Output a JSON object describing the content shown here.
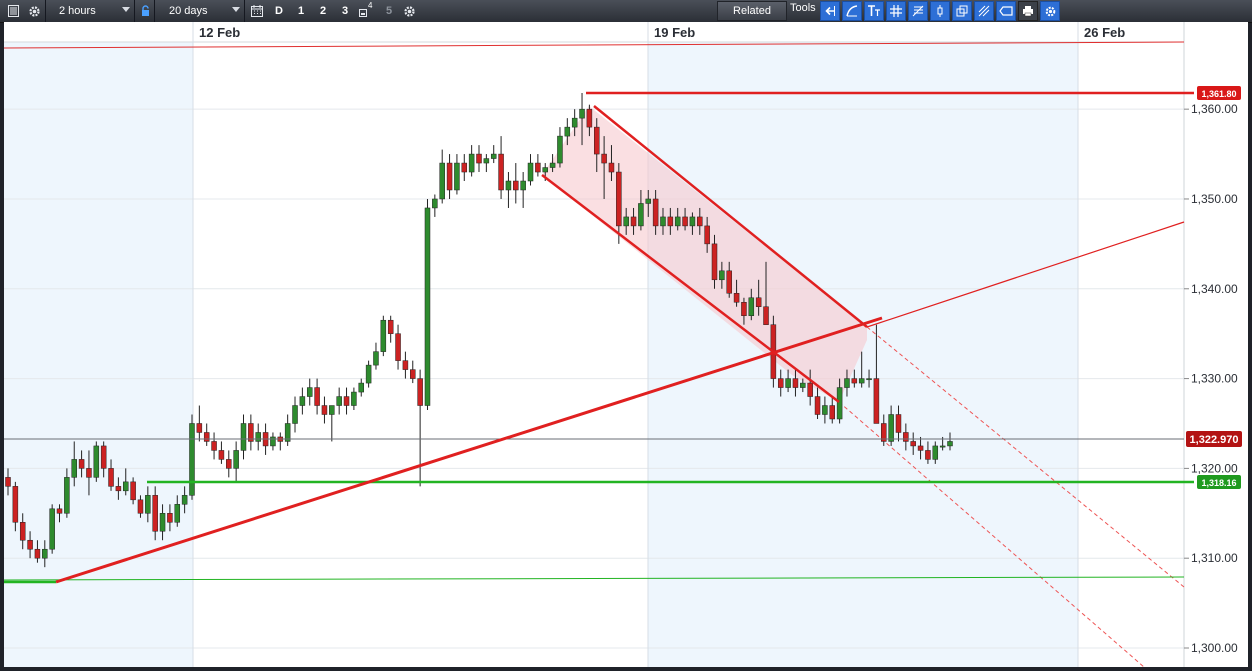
{
  "toolbar": {
    "interval": "2 hours",
    "range": "20 days",
    "period_d": "D",
    "period_1": "1",
    "period_2": "2",
    "period_3": "3",
    "period_4_sup": "4",
    "period_5": "5",
    "related": "Related",
    "tools": "Tools",
    "tool_icons": [
      "arrow-back-icon",
      "curve-icon",
      "text-tool-icon",
      "grid-icon",
      "fib-icon",
      "candle-icon",
      "layers-icon",
      "pitchfork-icon",
      "tag-icon",
      "print-icon",
      "settings-blue-icon"
    ]
  },
  "chart_data": {
    "type": "candlestick",
    "x_dates": [
      "12 Feb",
      "19 Feb",
      "26 Feb"
    ],
    "yticks": [
      "1,360.00",
      "1,350.00",
      "1,340.00",
      "1,330.00",
      "1,320.00",
      "1,310.00",
      "1,300.00"
    ],
    "ylim": [
      1297,
      1367
    ],
    "last_price": "1,322.970",
    "resistance_label": "1,361.80",
    "support_label": "1,318.16",
    "colors": {
      "up": "#2e8b2e",
      "down": "#cc2222",
      "resistance": "#e02020",
      "support": "#22b422"
    },
    "candles": [
      [
        1319,
        1320,
        1317,
        1318
      ],
      [
        1318,
        1318.5,
        1313,
        1314
      ],
      [
        1314,
        1315,
        1311,
        1312
      ],
      [
        1312,
        1313,
        1310,
        1311
      ],
      [
        1311,
        1312,
        1309.5,
        1310
      ],
      [
        1310,
        1312,
        1309,
        1311
      ],
      [
        1311,
        1316,
        1310.5,
        1315.5
      ],
      [
        1315.5,
        1316,
        1314,
        1315
      ],
      [
        1315,
        1320,
        1314.5,
        1319
      ],
      [
        1319,
        1323,
        1318,
        1321
      ],
      [
        1321,
        1322,
        1319,
        1320
      ],
      [
        1320,
        1322,
        1317,
        1319
      ],
      [
        1319,
        1323,
        1318.5,
        1322.5
      ],
      [
        1322.5,
        1323,
        1319,
        1320
      ],
      [
        1320,
        1321,
        1317.5,
        1318
      ],
      [
        1318,
        1319,
        1316.5,
        1317.5
      ],
      [
        1317.5,
        1320,
        1317,
        1318.5
      ],
      [
        1318.5,
        1319,
        1316,
        1316.5
      ],
      [
        1316.5,
        1317,
        1314.5,
        1315
      ],
      [
        1315,
        1318,
        1314,
        1317
      ],
      [
        1317,
        1318,
        1312,
        1313
      ],
      [
        1313,
        1316,
        1312,
        1315
      ],
      [
        1315,
        1316,
        1313,
        1314
      ],
      [
        1314,
        1317,
        1313.5,
        1316
      ],
      [
        1316,
        1318,
        1315,
        1317
      ],
      [
        1317,
        1326,
        1316.5,
        1325
      ],
      [
        1325,
        1327,
        1323,
        1324
      ],
      [
        1324,
        1325,
        1322.5,
        1323
      ],
      [
        1323,
        1324,
        1321,
        1322
      ],
      [
        1322,
        1323,
        1320.5,
        1321
      ],
      [
        1321,
        1322,
        1319,
        1320
      ],
      [
        1320,
        1323,
        1318.5,
        1322
      ],
      [
        1322,
        1326,
        1321,
        1325
      ],
      [
        1325,
        1326,
        1322,
        1323
      ],
      [
        1323,
        1325,
        1322,
        1324
      ],
      [
        1324,
        1325,
        1321.5,
        1322.5
      ],
      [
        1322.5,
        1324,
        1322,
        1323.5
      ],
      [
        1323.5,
        1324,
        1322,
        1323
      ],
      [
        1323,
        1326,
        1322.5,
        1325
      ],
      [
        1325,
        1328,
        1324,
        1327
      ],
      [
        1327,
        1329,
        1326,
        1328
      ],
      [
        1328,
        1330,
        1327,
        1329
      ],
      [
        1329,
        1330,
        1326,
        1327
      ],
      [
        1327,
        1328,
        1325,
        1326
      ],
      [
        1326,
        1327,
        1323,
        1327
      ],
      [
        1327,
        1329,
        1326,
        1328
      ],
      [
        1328,
        1329,
        1326,
        1327
      ],
      [
        1327,
        1329,
        1326.5,
        1328.5
      ],
      [
        1328.5,
        1330,
        1328,
        1329.5
      ],
      [
        1329.5,
        1332,
        1329,
        1331.5
      ],
      [
        1331.5,
        1334,
        1331,
        1333
      ],
      [
        1333,
        1337,
        1332.5,
        1336.5
      ],
      [
        1336.5,
        1337,
        1334,
        1335
      ],
      [
        1335,
        1336,
        1331,
        1332
      ],
      [
        1332,
        1333,
        1330,
        1331
      ],
      [
        1331,
        1332,
        1329.5,
        1330
      ],
      [
        1330,
        1331,
        1318,
        1327
      ],
      [
        1327,
        1350,
        1326.5,
        1349
      ],
      [
        1349,
        1350.5,
        1348,
        1350
      ],
      [
        1350,
        1355.5,
        1349.5,
        1354
      ],
      [
        1354,
        1355,
        1350,
        1351
      ],
      [
        1351,
        1355,
        1350.5,
        1354
      ],
      [
        1354,
        1355,
        1352,
        1353
      ],
      [
        1353,
        1356,
        1352.5,
        1355
      ],
      [
        1355,
        1356,
        1353,
        1354
      ],
      [
        1354,
        1355,
        1353,
        1354.5
      ],
      [
        1354.5,
        1356,
        1354,
        1355
      ],
      [
        1355,
        1357,
        1350,
        1351
      ],
      [
        1351,
        1353,
        1349,
        1352
      ],
      [
        1352,
        1354,
        1349.5,
        1351
      ],
      [
        1351,
        1353,
        1349,
        1352
      ],
      [
        1352,
        1355,
        1351.5,
        1354
      ],
      [
        1354,
        1355,
        1352.5,
        1353
      ],
      [
        1353,
        1354,
        1352,
        1353.5
      ],
      [
        1353.5,
        1355,
        1353,
        1354
      ],
      [
        1354,
        1358,
        1353.5,
        1357
      ],
      [
        1357,
        1359,
        1356,
        1358
      ],
      [
        1358,
        1360,
        1357,
        1359
      ],
      [
        1359,
        1361.8,
        1356,
        1360
      ],
      [
        1360,
        1360.5,
        1357,
        1358
      ],
      [
        1358,
        1359,
        1353,
        1355
      ],
      [
        1355,
        1357,
        1350,
        1354
      ],
      [
        1354,
        1356,
        1352,
        1353
      ],
      [
        1353,
        1354,
        1345,
        1347
      ],
      [
        1347,
        1349,
        1346,
        1348
      ],
      [
        1348,
        1349,
        1346,
        1347
      ],
      [
        1347,
        1351,
        1346.5,
        1349.5
      ],
      [
        1349.5,
        1351,
        1348,
        1350
      ],
      [
        1350,
        1351,
        1346,
        1347
      ],
      [
        1347,
        1349,
        1346,
        1348
      ],
      [
        1348,
        1349,
        1346,
        1347
      ],
      [
        1347,
        1349,
        1346.5,
        1348
      ],
      [
        1348,
        1349,
        1346.5,
        1347
      ],
      [
        1347,
        1348.5,
        1346,
        1348
      ],
      [
        1348,
        1349,
        1346,
        1347
      ],
      [
        1347,
        1348,
        1344,
        1345
      ],
      [
        1345,
        1346,
        1340,
        1341
      ],
      [
        1341,
        1343,
        1340,
        1342
      ],
      [
        1342,
        1343,
        1339,
        1339.5
      ],
      [
        1339.5,
        1341,
        1338,
        1338.5
      ],
      [
        1338.5,
        1339,
        1336,
        1337
      ],
      [
        1337,
        1340,
        1336.5,
        1339
      ],
      [
        1339,
        1341,
        1337,
        1338
      ],
      [
        1338,
        1343,
        1337,
        1336
      ],
      [
        1336,
        1337,
        1329,
        1330
      ],
      [
        1330,
        1331,
        1328,
        1329
      ],
      [
        1329,
        1331,
        1328.5,
        1330
      ],
      [
        1330,
        1331,
        1328,
        1329
      ],
      [
        1329,
        1330,
        1328.5,
        1329.5
      ],
      [
        1329.5,
        1331,
        1327,
        1328
      ],
      [
        1328,
        1329,
        1325.5,
        1326
      ],
      [
        1326,
        1328,
        1325,
        1327
      ],
      [
        1327,
        1328,
        1325,
        1325.5
      ],
      [
        1325.5,
        1330,
        1325,
        1329
      ],
      [
        1329,
        1331,
        1328,
        1330
      ],
      [
        1330,
        1331,
        1329,
        1329.5
      ],
      [
        1329.5,
        1333,
        1329,
        1330
      ],
      [
        1330,
        1331,
        1329,
        1330
      ],
      [
        1330,
        1336,
        1329.5,
        1325
      ],
      [
        1325,
        1326,
        1322.5,
        1323
      ],
      [
        1323,
        1327,
        1322.5,
        1326
      ],
      [
        1326,
        1327,
        1323,
        1324
      ],
      [
        1324,
        1325,
        1322,
        1323
      ],
      [
        1323,
        1324,
        1321.5,
        1322.5
      ],
      [
        1322.5,
        1323.5,
        1321,
        1322
      ],
      [
        1322,
        1323,
        1320.5,
        1321
      ],
      [
        1321,
        1323,
        1320.5,
        1322.5
      ],
      [
        1322.5,
        1323.5,
        1322,
        1322.5
      ],
      [
        1322.5,
        1324,
        1322,
        1323
      ]
    ]
  }
}
